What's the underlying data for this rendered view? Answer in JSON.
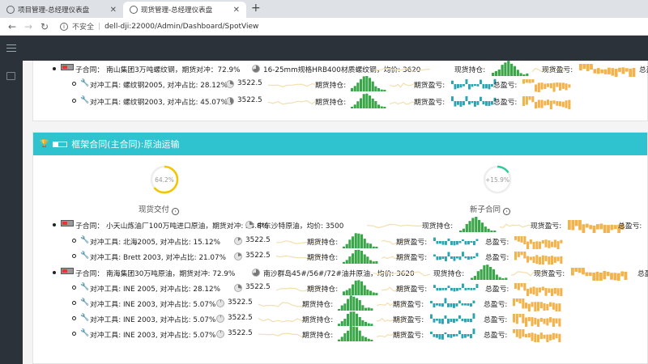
{
  "browser": {
    "tabs": [
      {
        "label": "项目管理-总经理仪表盘"
      },
      {
        "label": "现货管理-总经理仪表盘"
      }
    ],
    "new_tab": "+",
    "security": "不安全",
    "url": "dell-dji:22000/Admin/Dashboard/SpotView"
  },
  "panel_top": {
    "contract": {
      "text": "子合同：  南山集团3万吨螺纹钢，期货对冲：72.9%",
      "goods": "16-25mm规格HRB400材质螺纹钢，均价: 3620",
      "hedge_pct": 0.729,
      "label_spot_pos": "现货持仓:",
      "label_spot_pnl": "现货盈亏:",
      "label_total_pnl": "总盈"
    },
    "tools": [
      {
        "text": "对冲工具: 螺纹钢2005, 对冲占比: 28.12%",
        "pct": 0.2812,
        "price": "3522.5",
        "label_pos": "期货持仓:",
        "label_pnl": "期货盈亏:",
        "label_total": "总盈亏:"
      },
      {
        "text": "对冲工具: 螺纹钢2003, 对冲占比: 45.07%",
        "pct": 0.4507,
        "price": "3522.5",
        "label_pos": "期货持仓:",
        "label_pnl": "期货盈亏:",
        "label_total": "总盈亏:"
      }
    ]
  },
  "panel_main": {
    "title": "框架合同(主合同):原油运输",
    "gauges": [
      {
        "value": "64.2%",
        "fraction": 0.642,
        "color": "#f5c400",
        "label": "现货交付"
      },
      {
        "value": "+15.9%",
        "fraction": 0.159,
        "color": "#2ecc9a",
        "label": "新子合同"
      }
    ],
    "contracts": [
      {
        "text": "子合同：  小天山炼油厂100万吨进口原油，期货对冲: 23.8%",
        "hedge_pct": 0.238,
        "goods": "中东沙特原油，均价: 3500",
        "label_spot_pos": "现货持仓:",
        "label_spot_pnl": "现货盈亏:",
        "label_total_pnl": "总盈亏:",
        "tools": [
          {
            "text": "对冲工具: 北海2005, 对冲占比: 15.12%",
            "pct": 0.1512,
            "price": "3522.5",
            "label_pos": "期货持仓:",
            "label_pnl": "期货盈亏:",
            "label_total": "总盈亏:"
          },
          {
            "text": "对冲工具: Brett 2003, 对冲占比: 21.07%",
            "pct": 0.2107,
            "price": "3522.5",
            "label_pos": "期货持仓:",
            "label_pnl": "期货盈亏:",
            "label_total": "总盈亏:"
          }
        ]
      },
      {
        "text": "子合同：  南海集团30万吨原油，期货对冲: 72.9%",
        "hedge_pct": 0.729,
        "goods": "南沙群岛45#/56#/72#油井原油，均价: 3620",
        "label_spot_pos": "现货持仓:",
        "label_spot_pnl": "现货盈亏:",
        "label_total_pnl": "总盈",
        "tools": [
          {
            "text": "对冲工具: INE 2005, 对冲占比: 28.12%",
            "pct": 0.2812,
            "price": "3522.5",
            "label_pos": "期货持仓:",
            "label_pnl": "期货盈亏:",
            "label_total": "总盈亏:"
          },
          {
            "text": "对冲工具: INE 2003, 对冲占比: 5.07%",
            "pct": 0.0507,
            "price": "3522.5",
            "label_pos": "期货持仓:",
            "label_pnl": "期货盈亏:",
            "label_total": "总盈亏:"
          },
          {
            "text": "对冲工具: INE 2003, 对冲占比: 5.07%",
            "pct": 0.0507,
            "price": "3522.5",
            "label_pos": "期货持仓:",
            "label_pnl": "期货盈亏:",
            "label_total": "总盈亏:"
          },
          {
            "text": "对冲工具: INE 2003, 对冲占比: 5.07%",
            "pct": 0.0507,
            "price": "3522.5",
            "label_pos": "期货持仓:",
            "label_pnl": "期货盈亏:",
            "label_total": "总盈亏:"
          }
        ]
      }
    ]
  },
  "colors": {
    "teal_header": "#2fc3cf",
    "position_bars": "#3aa64a",
    "pnl_bars": "#2aa4b0",
    "total_bars": "#f2b34c",
    "pie": "#777777",
    "sparkline": "#f2dfb0"
  }
}
